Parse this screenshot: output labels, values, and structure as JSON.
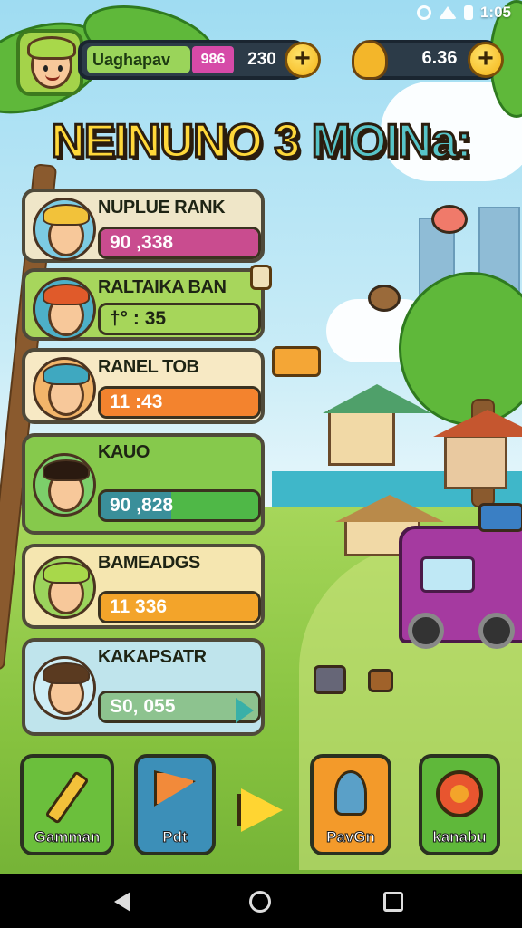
{
  "status_bar": {
    "time": "1:05"
  },
  "player": {
    "name": "Uaghapav",
    "level": "986",
    "coins": "230",
    "add_label": "+"
  },
  "currency": {
    "value": "6.36",
    "add_label": "+"
  },
  "title": {
    "part1": "NEINUNO 3",
    "part2": "MOINa:"
  },
  "leaderboard": [
    {
      "name": "NUPLUE RANK",
      "score": "90 ,338",
      "bar_color": "#c94c8f",
      "fill": 1.0
    },
    {
      "name": "RALTAIKA BAN",
      "score": "†° :  35",
      "bar_color": "#a6d65a",
      "fill": 1.0
    },
    {
      "name": "RANEL TOB",
      "score": "11 :43",
      "bar_color": "#f3832e",
      "fill": 1.0
    },
    {
      "name": "KAUO",
      "score": "90 ,828",
      "bar_color": "#4fb847",
      "fill": 0.55
    },
    {
      "name": "BAMEADGS",
      "score": "11  336",
      "bar_color": "#f3a42a",
      "fill": 1.0
    },
    {
      "name": "KAKAPSATR",
      "score": "S0, 055",
      "bar_color": "#8dc38f",
      "fill": 1.0
    }
  ],
  "bottom_buttons": [
    {
      "label": "Gamman",
      "color": "#6bbf3c"
    },
    {
      "label": "Pdt",
      "color": "#3c8fb8"
    },
    {
      "label": "PavGn",
      "color": "#f39a2a"
    },
    {
      "label": "kanabu",
      "color": "#5fb83a"
    }
  ],
  "icons": {
    "settings": "gear-icon",
    "wifi": "wifi-icon",
    "battery": "battery-icon",
    "next": "arrow-right-icon"
  }
}
